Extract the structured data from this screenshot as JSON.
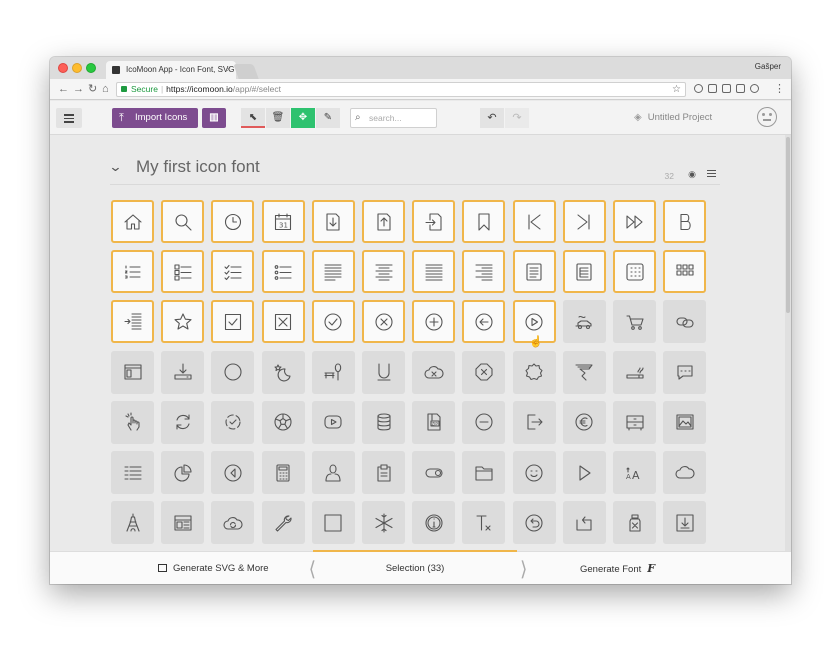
{
  "browser": {
    "tab_title": "IcoMoon App - Icon Font, SVG",
    "tab_close": "×",
    "user": "Gašper",
    "url_secure": "Secure",
    "url_separator": "|",
    "url_domain": "https://icomoon.io",
    "url_path": "/app/#/select"
  },
  "toolbar": {
    "import_label": "Import Icons",
    "search_placeholder": "search...",
    "project_name": "Untitled Project"
  },
  "iconset": {
    "title": "My first icon font",
    "count": "32"
  },
  "grid": {
    "columns": 12,
    "rows": [
      [
        "home-icon",
        "search-icon",
        "clock-icon",
        "calendar-icon",
        "file-download-icon",
        "file-upload-icon",
        "file-import-icon",
        "bookmark-icon",
        "skip-back-icon",
        "skip-forward-icon",
        "fast-forward-icon",
        "bold-b-icon"
      ],
      [
        "list-numbered-icon",
        "list-checkbox-icon",
        "list-checks-icon",
        "list-bullets-icon",
        "align-left-icon",
        "align-center-icon",
        "align-justify-icon",
        "align-right-icon",
        "document-lines-icon",
        "document-text-icon",
        "grid-dots-icon",
        "grid-small-icon"
      ],
      [
        "indent-icon",
        "star-icon",
        "checkbox-checked-icon",
        "checkbox-cross-icon",
        "circle-check-icon",
        "circle-x-icon",
        "circle-plus-icon",
        "circle-arrow-left-icon",
        "circle-play-icon",
        "car-icon",
        "cart-icon",
        "chain-link-icon"
      ],
      [
        "browser-window-icon",
        "download-tray-icon",
        "circle-outline-icon",
        "moon-star-icon",
        "park-bench-icon",
        "magnet-u-icon",
        "cloud-x-icon",
        "octagon-x-icon",
        "gear-badge-icon",
        "tornado-icon",
        "cigarette-icon",
        "chat-bubble-icon"
      ],
      [
        "hand-tap-icon",
        "refresh-icon",
        "sync-check-icon",
        "soccer-ball-icon",
        "youtube-icon",
        "database-icon",
        "zip-file-icon",
        "circle-minus-icon",
        "sign-out-icon",
        "euro-coin-icon",
        "dresser-icon",
        "picture-icon"
      ],
      [
        "list-lines-icon",
        "pie-chart-icon",
        "circle-back-icon",
        "calculator-icon",
        "user-bust-icon",
        "clipboard-icon",
        "toggle-icon",
        "folder-icon",
        "smiley-face-icon",
        "play-triangle-icon",
        "font-size-icon",
        "cloud-icon"
      ],
      [
        "eiffel-tower-icon",
        "layout-panels-icon",
        "cloud-sync-icon",
        "wrench-icon",
        "square-outline-icon",
        "snowflake-icon",
        "info-circle-icon",
        "clear-format-icon",
        "circle-undo-icon",
        "rotate-box-icon",
        "jar-icon",
        "download-box-icon"
      ]
    ],
    "selected_count": 33
  },
  "footer": {
    "generate_svg_label": "Generate SVG & More",
    "selection_label": "Selection (33)",
    "generate_font_label": "Generate Font",
    "font_glyph": "F"
  }
}
